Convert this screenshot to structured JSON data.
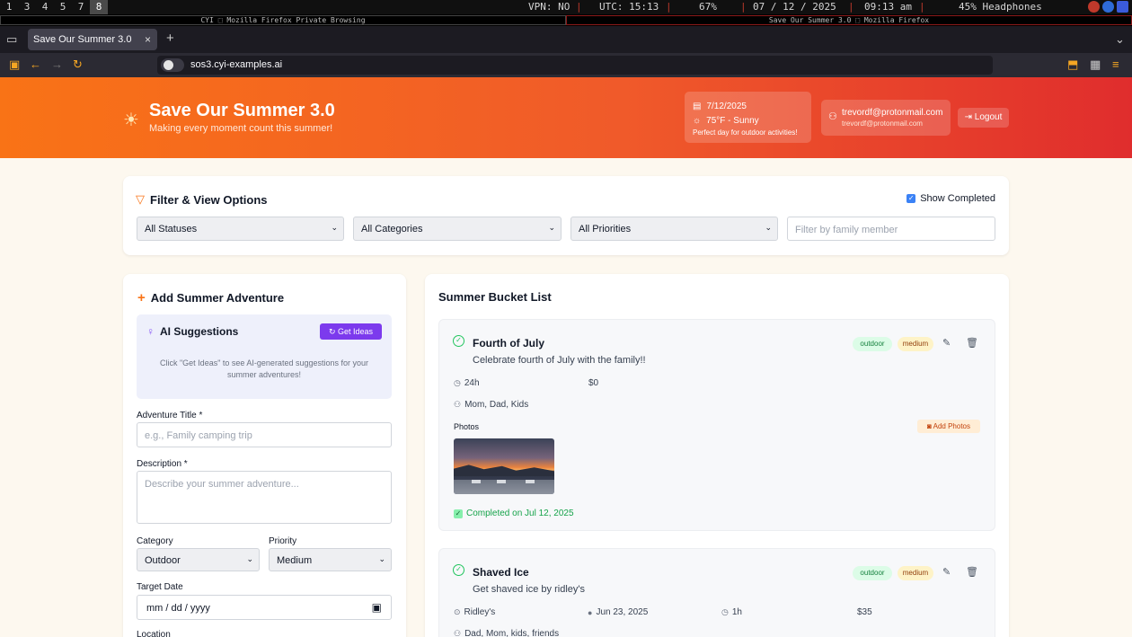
{
  "system_bar": {
    "workspaces": [
      "1",
      "3",
      "4",
      "5",
      "7",
      "8"
    ],
    "active_workspace": "8",
    "vpn": "VPN: NO",
    "utc": "UTC: 15:13",
    "battery": "67%",
    "date": "07 / 12 / 2025",
    "time": "09:13 am",
    "audio": "45% Headphones"
  },
  "window_titles": {
    "left": "CYI ⬚ Mozilla Firefox Private Browsing",
    "right": "Save Our Summer 3.0 ⬚ Mozilla Firefox"
  },
  "browser": {
    "tab_title": "Save Our Summer 3.0",
    "url_domain": "sos3.cyi-examples.ai"
  },
  "header": {
    "title": "Save Our Summer 3.0",
    "subtitle": "Making every moment count this summer!",
    "weather_date": "7/12/2025",
    "weather_temp": "75°F - Sunny",
    "weather_note": "Perfect day for outdoor activities!",
    "user_email": "trevordf@protonmail.com",
    "user_email_small": "trevordf@protonmail.com",
    "logout_label": "Logout"
  },
  "filters": {
    "title": "Filter & View Options",
    "show_completed_label": "Show Completed",
    "show_completed_checked": true,
    "status_value": "All Statuses",
    "category_value": "All Categories",
    "priority_value": "All Priorities",
    "member_placeholder": "Filter by family member"
  },
  "add_form": {
    "title": "Add Summer Adventure",
    "ai_title": "AI Suggestions",
    "get_ideas_label": "Get Ideas",
    "ai_description": "Click \"Get Ideas\" to see AI-generated suggestions for your summer adventures!",
    "title_label": "Adventure Title *",
    "title_placeholder": "e.g., Family camping trip",
    "description_label": "Description *",
    "description_placeholder": "Describe your summer adventure...",
    "category_label": "Category",
    "category_value": "Outdoor",
    "priority_label": "Priority",
    "priority_value": "Medium",
    "date_label": "Target Date",
    "date_value": "mm / dd / yyyy",
    "location_label": "Location"
  },
  "bucket_list": {
    "title": "Summer Bucket List",
    "items": [
      {
        "title": "Fourth of July",
        "description": "Celebrate fourth of July with the family!!",
        "category": "outdoor",
        "priority": "medium",
        "duration": "24h",
        "cost": "$0",
        "members": "Mom, Dad, Kids",
        "photos_label": "Photos",
        "add_photos_label": "Add Photos",
        "completed_text": "Completed on Jul 12, 2025"
      },
      {
        "title": "Shaved Ice",
        "description": "Get shaved ice by ridley's",
        "category": "outdoor",
        "priority": "medium",
        "location": "Ridley's",
        "date": "Jun 23, 2025",
        "duration": "1h",
        "cost": "$35",
        "members": "Dad, Mom, kids, friends"
      }
    ]
  },
  "colors": {
    "header_start": "#f97316",
    "header_end": "#e02d2d",
    "accent_purple": "#7c3aed",
    "complete_green": "#16a34a"
  }
}
